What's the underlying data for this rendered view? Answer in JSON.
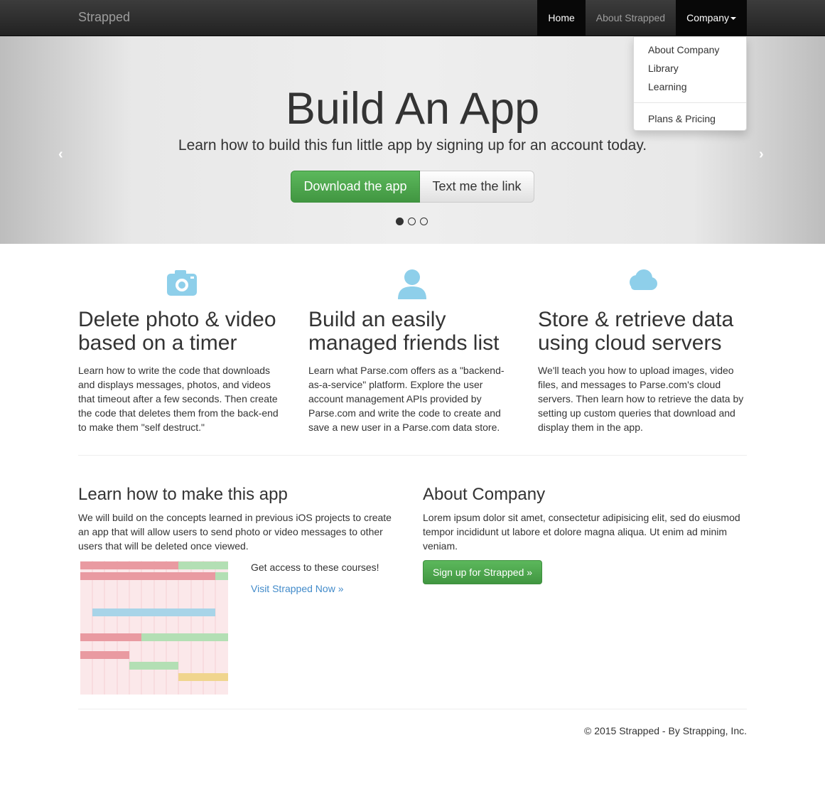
{
  "nav": {
    "brand": "Strapped",
    "items": [
      {
        "label": "Home"
      },
      {
        "label": "About Strapped"
      },
      {
        "label": "Company"
      }
    ]
  },
  "dropdown": {
    "items": [
      "About Company",
      "Library",
      "Learning"
    ],
    "extra": "Plans & Pricing"
  },
  "hero": {
    "title": "Build An App",
    "subtitle": "Learn how to build this fun little app by signing up for an account today.",
    "primary_button": "Download the app",
    "secondary_button": "Text me the link",
    "prev_arrow": "‹",
    "next_arrow": "›"
  },
  "features": [
    {
      "icon": "camera-icon",
      "title": "Delete photo & video based on a timer",
      "text": "Learn how to write the code that downloads and displays messages, photos, and videos that timeout after a few seconds. Then create the code that deletes them from the back-end to make them \"self destruct.\""
    },
    {
      "icon": "user-icon",
      "title": "Build an easily managed friends list",
      "text": "Learn what Parse.com offers as a \"backend-as-a-service\" platform. Explore the user account management APIs provided by Parse.com and write the code to create and save a new user in a Parse.com data store."
    },
    {
      "icon": "cloud-icon",
      "title": "Store & retrieve data using cloud servers",
      "text": "We'll teach you how to upload images, video files, and messages to Parse.com's cloud servers. Then learn how to retrieve the data by setting up custom queries that download and display them in the app."
    }
  ],
  "learn": {
    "title": "Learn how to make this app",
    "text": "We will build on the concepts learned in previous iOS projects to create an app that will allow users to send photo or video messages to other users that will be deleted once viewed.",
    "courses_text": "Get access to these courses!",
    "courses_link": "Visit Strapped Now »"
  },
  "about": {
    "title": "About Company",
    "text": "Lorem ipsum dolor sit amet, consectetur adipisicing elit, sed do eiusmod tempor incididunt ut labore et dolore magna aliqua. Ut enim ad minim veniam.",
    "button": "Sign up for Strapped »"
  },
  "colors": {
    "accent_green": "#5cb85c",
    "link_blue": "#428bca",
    "icon_blue": "#8ecfea",
    "schedule_red": "#e99aa1",
    "schedule_green": "#b3dfb4",
    "schedule_blue": "#a8d4e8",
    "schedule_yellow": "#f0d58e"
  },
  "footer": {
    "text": "© 2015 Strapped - By Strapping, Inc."
  }
}
